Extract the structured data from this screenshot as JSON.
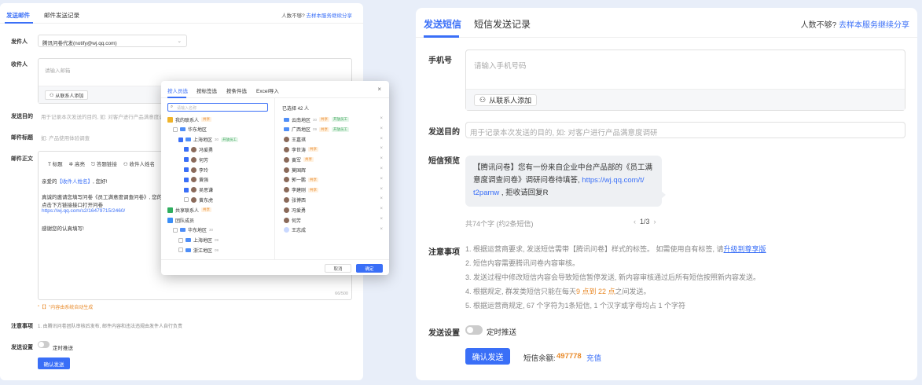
{
  "email": {
    "tabs": [
      "发送邮件",
      "邮件发送记录"
    ],
    "share_text": "人数不够?",
    "share_link": "去样本服务继续分享",
    "sender_label": "发件人",
    "sender_value": "腾讯问卷代发(notify@wj.qq.com)",
    "recipient_label": "收件人",
    "recipient_placeholder": "请输入邮箱",
    "add_contact": "从联系人添加",
    "purpose_label": "发送目的",
    "purpose_placeholder": "用于记录本次发送的目的, 如: 对客户进行产品满意度调研",
    "subject_label": "邮件标题",
    "subject_placeholder": "如: 产品使用体验调查",
    "body_label": "邮件正文",
    "toolbar": [
      "标题",
      "高亮",
      "答题链接",
      "收件人姓名"
    ],
    "body_lines": [
      "亲爱的【收件人姓名】, 您好!",
      "真诚的邀请您填写问卷《员工满意度调查问卷》, 您的",
      "点击下方链接接口打开问卷",
      "https://wj.qq.com/s2/16479715/2460/",
      "感谢您的认真填写!"
    ],
    "counter": "66/500",
    "auto_note": "\"【】\"内容由系统自动生成",
    "notice_label": "注意事项",
    "notice_text": "1. 由腾讯问卷团队审核后发布, 邮件内容和违法违规由发件人自行负责",
    "send_setting_label": "发送设置",
    "timed_send": "定时推送",
    "confirm": "确认发送"
  },
  "modal": {
    "tabs": [
      "按人员选",
      "按标签选",
      "按条件选",
      "Excel导入"
    ],
    "search_placeholder": "请输入名称",
    "tree": [
      {
        "label": "我的联系人",
        "tag": "共享",
        "tagc": "o",
        "indent": 0,
        "icon": "me",
        "cb": false
      },
      {
        "label": "华东地区",
        "tag": "",
        "indent": 1,
        "icon": "folder",
        "cb": false
      },
      {
        "label": "上海地区",
        "count": "30",
        "tag": "开放员工",
        "tagc": "g",
        "indent": 2,
        "icon": "folder",
        "cb": true
      },
      {
        "label": "冯爱勇",
        "tag": "",
        "indent": 3,
        "icon": "avatar",
        "cb": true
      },
      {
        "label": "何芳",
        "tag": "",
        "indent": 3,
        "icon": "avatar",
        "cb": true
      },
      {
        "label": "李玲",
        "tag": "",
        "indent": 3,
        "icon": "avatar",
        "cb": true
      },
      {
        "label": "黄强",
        "tag": "",
        "indent": 3,
        "icon": "avatar",
        "cb": true
      },
      {
        "label": "吴思谦",
        "tag": "",
        "indent": 3,
        "icon": "avatar",
        "cb": true
      },
      {
        "label": "黄东虎",
        "tag": "",
        "indent": 3,
        "icon": "avatar",
        "cb": false
      },
      {
        "label": "共享联系人",
        "tag": "共享",
        "tagc": "o",
        "indent": 0,
        "icon": "share",
        "cb": false
      },
      {
        "label": "团队成员",
        "tag": "",
        "indent": 0,
        "icon": "team",
        "cb": false
      },
      {
        "label": "华东地区",
        "count": "30",
        "tag": "",
        "indent": 1,
        "icon": "folder",
        "cb": false
      },
      {
        "label": "上海地区",
        "count": "09",
        "tag": "",
        "indent": 2,
        "icon": "folder",
        "cb": false
      },
      {
        "label": "浙江地区",
        "count": "09",
        "tag": "",
        "indent": 2,
        "icon": "folder",
        "cb": false
      }
    ],
    "selected_title": "已选择 42 人",
    "selected": [
      {
        "label": "云南地区",
        "count": "30",
        "tag": "共享",
        "tagc": "o",
        "tag2": "开放员工",
        "icon": "folder"
      },
      {
        "label": "广西地区",
        "count": "09",
        "tag": "共享",
        "tagc": "o",
        "tag2": "开放员工",
        "icon": "folder"
      },
      {
        "label": "王嘉琪",
        "icon": "avatar"
      },
      {
        "label": "李世涛",
        "tag": "共享",
        "tagc": "o",
        "icon": "avatar"
      },
      {
        "label": "黄军",
        "tag": "共享",
        "tagc": "o",
        "icon": "avatar"
      },
      {
        "label": "莫国辉",
        "icon": "avatar"
      },
      {
        "label": "郭一鹏",
        "tag": "共享",
        "tagc": "o",
        "icon": "avatar"
      },
      {
        "label": "李建刚",
        "tag": "共享",
        "tagc": "o",
        "icon": "avatar"
      },
      {
        "label": "张博西",
        "icon": "avatar"
      },
      {
        "label": "冯爱勇",
        "icon": "avatar"
      },
      {
        "label": "何芳",
        "icon": "avatar"
      },
      {
        "label": "王志成",
        "icon": "initial"
      }
    ],
    "cancel": "取消",
    "ok": "确定"
  },
  "sms": {
    "tabs": [
      "发送短信",
      "短信发送记录"
    ],
    "share_text": "人数不够?",
    "share_link": "去样本服务继续分享",
    "phone_label": "手机号",
    "phone_placeholder": "请输入手机号码",
    "add_contact": "从联系人添加",
    "purpose_label": "发送目的",
    "purpose_placeholder": "用于记录本次发送的目的, 如: 对客户进行产品满意度调研",
    "preview_label": "短信预览",
    "preview_l1": "【腾讯问卷】您有一份来自企业中台产品部的《员工满",
    "preview_l2a": "意度调查问卷》调研问卷待填答, ",
    "preview_l2b": "https://wj.qq.com/t/",
    "preview_l3a": "t2pamw",
    "preview_l3b": " , 拒收请回复R",
    "char_count": "共74个字 (约2条短信)",
    "pager": "1/3",
    "notice_label": "注意事项",
    "note1a": "1. 根据运营商要求, 发送短信需带【腾讯问卷】样式的标签。 如需使用自有标签, 请",
    "note1b": "升级到尊享版",
    "note2": "2. 短信内容需要腾讯问卷内容审核。",
    "note3": "3. 发送过程中修改短信内容会导致短信暂停发送, 新内容审核通过后所有短信按照新内容发送。",
    "note4a": "4. 根据规定, 群发类短信只能在每天",
    "note4b": "9 点到 22 点",
    "note4c": "之间发送。",
    "note5": "5. 根据运营商规定, 67 个字符为1条短信, 1 个汉字或字母均占 1 个字符",
    "send_setting_label": "发送设置",
    "timed_send": "定时推送",
    "confirm": "确认发送",
    "balance_label": "短信余额:",
    "balance_value": "497778",
    "recharge": "充值"
  }
}
